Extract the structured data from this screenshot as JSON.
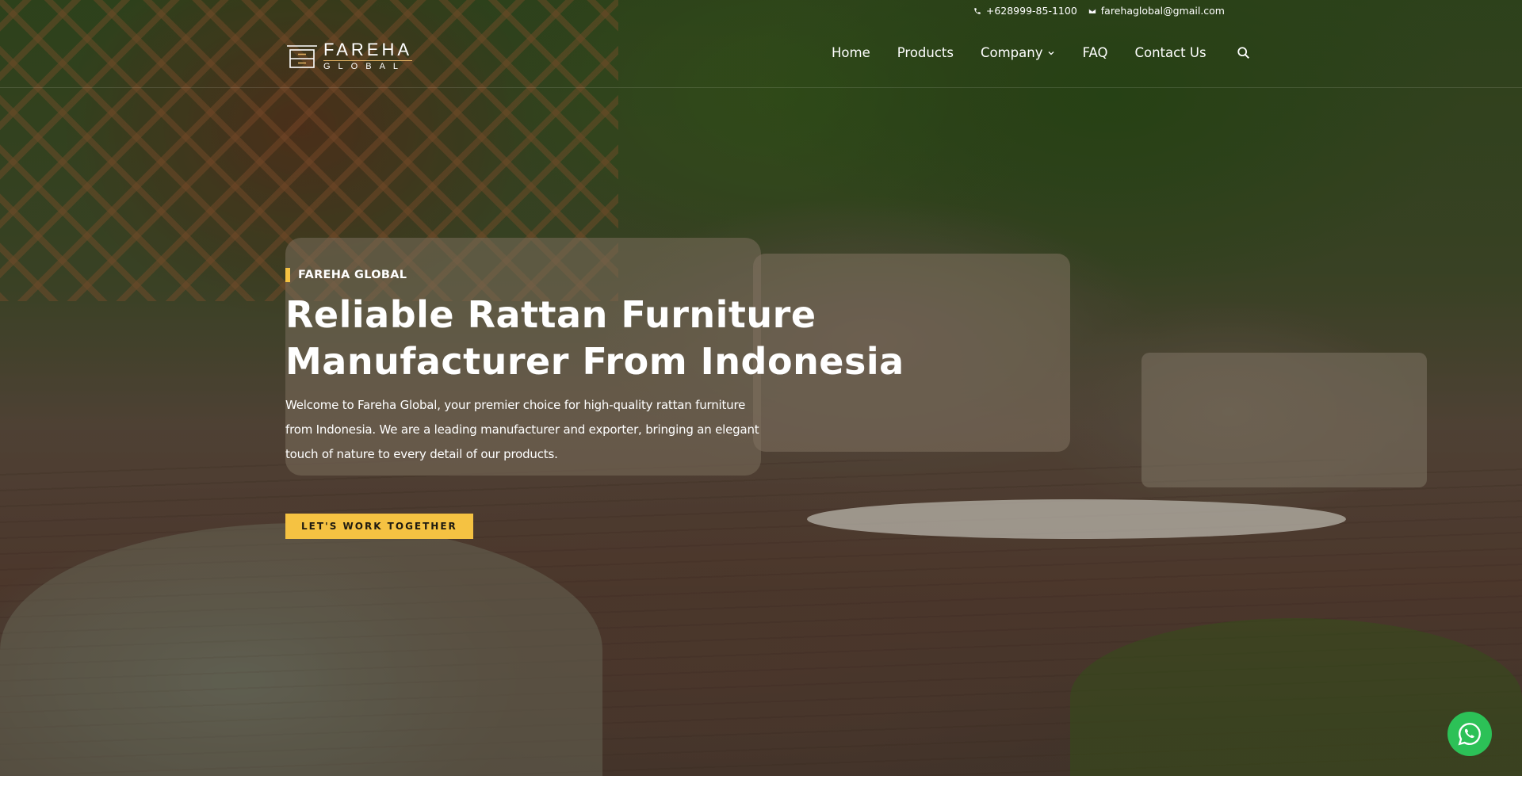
{
  "topbar": {
    "phone_icon": "phone-icon",
    "phone": "+628999-85-1100",
    "email_icon": "envelope-icon",
    "email": "farehaglobal@gmail.com"
  },
  "logo": {
    "line1": "FAREHA",
    "line2": "GLOBAL",
    "icon": "cabinet-logo-icon"
  },
  "nav": {
    "items": [
      {
        "label": "Home"
      },
      {
        "label": "Products"
      },
      {
        "label": "Company",
        "has_dropdown": true
      },
      {
        "label": "FAQ"
      },
      {
        "label": "Contact Us"
      }
    ],
    "search_icon": "search-icon"
  },
  "hero": {
    "eyebrow": "FAREHA GLOBAL",
    "title_line1": "Reliable Rattan Furniture",
    "title_line2": "Manufacturer From Indonesia",
    "description": "Welcome to Fareha Global, your premier choice for high-quality rattan furniture from Indonesia. We are a leading manufacturer and exporter, bringing an elegant touch of nature to every detail of our products.",
    "cta_label": "LET'S WORK TOGETHER",
    "accent_color": "#f5c242"
  },
  "floating": {
    "whatsapp_icon": "whatsapp-icon",
    "color": "#2cc157"
  }
}
